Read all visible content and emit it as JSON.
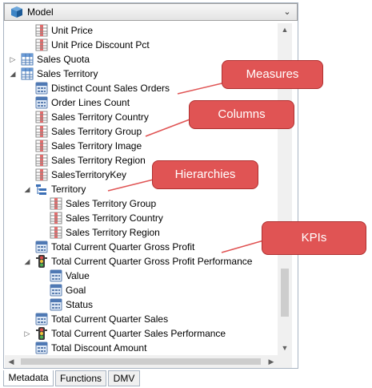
{
  "model_selector": {
    "label": "Model",
    "icon": "cube-icon"
  },
  "tree": [
    {
      "indent": 1,
      "label": "Unit Price",
      "icon": "column-icon",
      "expander": ""
    },
    {
      "indent": 1,
      "label": "Unit Price Discount Pct",
      "icon": "column-icon",
      "expander": ""
    },
    {
      "indent": 0,
      "label": "Sales Quota",
      "icon": "table-icon",
      "expander": "▷"
    },
    {
      "indent": 0,
      "label": "Sales Territory",
      "icon": "table-icon",
      "expander": "◢"
    },
    {
      "indent": 1,
      "label": "Distinct Count Sales Orders",
      "icon": "measure-icon",
      "expander": ""
    },
    {
      "indent": 1,
      "label": "Order Lines Count",
      "icon": "measure-icon",
      "expander": ""
    },
    {
      "indent": 1,
      "label": "Sales Territory Country",
      "icon": "column-icon",
      "expander": ""
    },
    {
      "indent": 1,
      "label": "Sales Territory Group",
      "icon": "column-icon",
      "expander": ""
    },
    {
      "indent": 1,
      "label": "Sales Territory Image",
      "icon": "column-icon",
      "expander": ""
    },
    {
      "indent": 1,
      "label": "Sales Territory Region",
      "icon": "column-icon",
      "expander": ""
    },
    {
      "indent": 1,
      "label": "SalesTerritoryKey",
      "icon": "column-icon",
      "expander": ""
    },
    {
      "indent": 1,
      "label": "Territory",
      "icon": "hierarchy-icon",
      "expander": "◢"
    },
    {
      "indent": 2,
      "label": "Sales Territory Group",
      "icon": "column-icon",
      "expander": ""
    },
    {
      "indent": 2,
      "label": "Sales Territory Country",
      "icon": "column-icon",
      "expander": ""
    },
    {
      "indent": 2,
      "label": "Sales Territory Region",
      "icon": "column-icon",
      "expander": ""
    },
    {
      "indent": 1,
      "label": "Total Current Quarter Gross Profit",
      "icon": "measure-icon",
      "expander": ""
    },
    {
      "indent": 1,
      "label": "Total Current Quarter Gross Profit Performance",
      "icon": "kpi-icon",
      "expander": "◢"
    },
    {
      "indent": 2,
      "label": "Value",
      "icon": "measure-icon",
      "expander": ""
    },
    {
      "indent": 2,
      "label": "Goal",
      "icon": "measure-icon",
      "expander": ""
    },
    {
      "indent": 2,
      "label": "Status",
      "icon": "measure-icon",
      "expander": ""
    },
    {
      "indent": 1,
      "label": "Total Current Quarter Sales",
      "icon": "measure-icon",
      "expander": ""
    },
    {
      "indent": 1,
      "label": "Total Current Quarter Sales Performance",
      "icon": "kpi-icon",
      "expander": "▷"
    },
    {
      "indent": 1,
      "label": "Total Discount Amount",
      "icon": "measure-icon",
      "expander": ""
    }
  ],
  "callouts": {
    "measures": "Measures",
    "columns": "Columns",
    "hierarchies": "Hierarchies",
    "kpis": "KPIs"
  },
  "tabs": [
    "Metadata",
    "Functions",
    "DMV"
  ],
  "active_tab": "Metadata",
  "scroll_up_icon": "scroll-up-icon",
  "scroll_down_icon": "scroll-down-icon",
  "colors": {
    "callout": "#e05454",
    "panel_border": "#a9b4c2"
  }
}
